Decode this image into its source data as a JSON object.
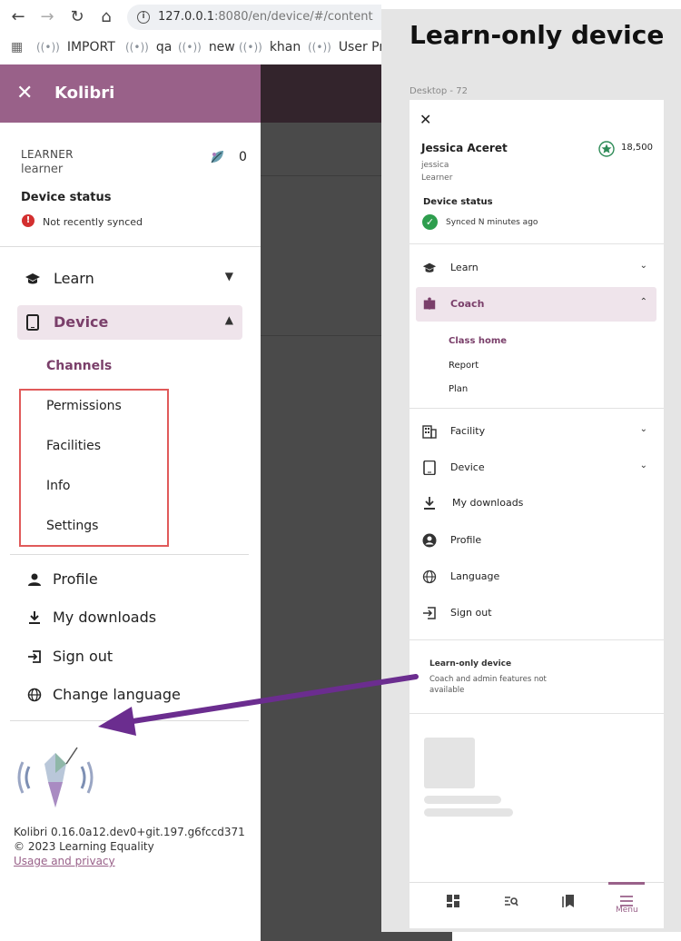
{
  "browser": {
    "url_host": "127.0.0.1",
    "url_rest": ":8080/en/device/#/content",
    "bookmarks": [
      "IMPORT",
      "qa",
      "new",
      "khan",
      "User Pro"
    ]
  },
  "drawer": {
    "title": "Kolibri",
    "user_role": "LEARNER",
    "username": "learner",
    "points": "0",
    "device_status_label": "Device status",
    "sync_status": "Not recently synced",
    "nav": [
      {
        "label": "Learn",
        "chevron": "⌄"
      },
      {
        "label": "Device",
        "chevron": "⌃"
      }
    ],
    "device_sub": [
      {
        "label": "Channels"
      },
      {
        "label": "Permissions"
      },
      {
        "label": "Facilities"
      },
      {
        "label": "Info"
      },
      {
        "label": "Settings"
      }
    ],
    "footer_items": [
      {
        "label": "Profile"
      },
      {
        "label": "My downloads"
      },
      {
        "label": "Sign out"
      },
      {
        "label": "Change language"
      }
    ],
    "version": "Kolibri 0.16.0a12.dev0+git.197.g6fccd371",
    "copyright": "© 2023 Learning Equality",
    "privacy_link": "Usage and privacy"
  },
  "mockup": {
    "title": "Learn-only device",
    "frame_label": "Desktop - 72",
    "name": "Jessica Aceret",
    "points": "18,500",
    "username": "jessica",
    "role": "Learner",
    "device_status_label": "Device status",
    "sync_status": "Synced N minutes ago",
    "nav": [
      {
        "label": "Learn"
      },
      {
        "label": "Coach"
      },
      {
        "label": "Facility"
      },
      {
        "label": "Device"
      },
      {
        "label": "My downloads"
      },
      {
        "label": "Profile"
      },
      {
        "label": "Language"
      },
      {
        "label": "Sign out"
      }
    ],
    "coach_sub": [
      {
        "label": "Class home"
      },
      {
        "label": "Report"
      },
      {
        "label": "Plan"
      }
    ],
    "note_title": "Learn-only device",
    "note_body": "Coach and admin features not available",
    "bottom_nav_active_label": "Menu"
  },
  "colors": {
    "brand": "#996189",
    "brand_dark": "#7a3f6a",
    "active_bg": "#efe4eb",
    "highlight_box": "#e05a5a",
    "arrow": "#6b2d8f"
  }
}
